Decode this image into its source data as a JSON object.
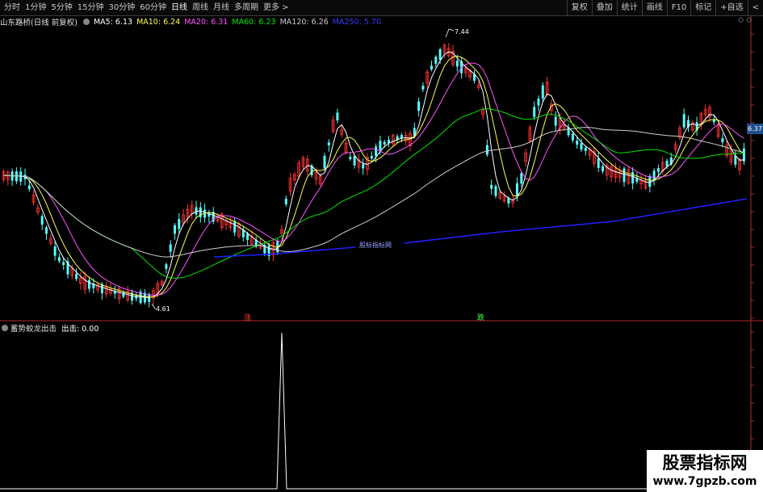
{
  "toolbar": {
    "tabs": [
      "分时",
      "1分钟",
      "5分钟",
      "15分钟",
      "30分钟",
      "60分钟",
      "日线",
      "周线",
      "月线",
      "多周期",
      "更多 >"
    ],
    "active_tab": "日线",
    "right_buttons": [
      "复权",
      "叠加",
      "统计",
      "画线",
      "F10",
      "标记",
      "+自选",
      "<"
    ]
  },
  "legend": {
    "title": "山东路桥(日线 前复权)",
    "ma5": "MA5: 6.13",
    "ma10": "MA10: 6.24",
    "ma20": "MA20: 6.31",
    "ma60": "MA60: 6.23",
    "ma120": "MA120: 6.26",
    "ma250": "MA250: 5.70",
    "colors": {
      "ma5": "#ffffff",
      "ma10": "#ffff4f",
      "ma20": "#ff55ff",
      "ma60": "#00e600",
      "ma120": "#cccccc",
      "ma250": "#2020ff"
    }
  },
  "annotations": {
    "high_label": "7.44",
    "low_label": "4.61",
    "center_text": "股标指标网",
    "up_marker": "涨",
    "down_marker": "跌",
    "price_tag": "6.37"
  },
  "indicator": {
    "name": "蓄势蛟龙出击",
    "value_label": "出击: 0.00"
  },
  "watermark": {
    "line1": "股票指标网",
    "line2": "www.7gpzb.com"
  },
  "corner_icons": "◇ ◇",
  "colors": {
    "up": "#ff3232",
    "down": "#54ffff",
    "background": "#000000",
    "axis": "#b4282d"
  }
}
